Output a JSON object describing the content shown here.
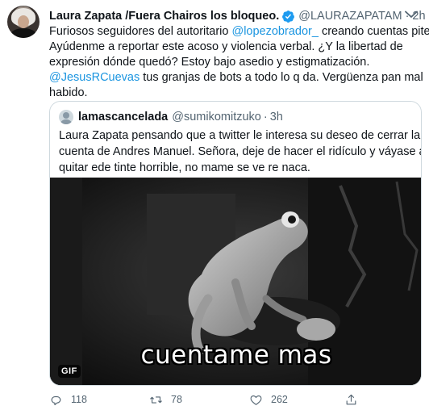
{
  "tweet": {
    "author_name": "Laura Zapata /Fuera Chairos los bloqueo.",
    "author_handle": "@LAURAZAPATAM",
    "separator": "·",
    "time": "2h",
    "text": {
      "line1_before": "Furiosos seguidores del autoritario ",
      "line1_mention": "@lopezobrador_",
      "line1_after": " creando cuentas piteras.",
      "line2": "Ayúdenme a reportar este acoso y violencia verbal. ¿Y la libertad de",
      "line3": "expresión dónde quedó? Estoy bajo asedio y estigmatización.",
      "line4_mention": "@JesusRCuevas",
      "line4_after": " tus granjas de bots a todo lo q da. Vergüenza pan mal",
      "line5": "habido."
    },
    "icons": {
      "avatar": "avatar-photo",
      "verified": "verified-badge-icon",
      "more": "chevron-down-icon"
    },
    "colors": {
      "link": "#1b95e0",
      "verified": "#1d9bf0",
      "secondary_text": "#536471"
    }
  },
  "quote": {
    "author_name": "lamascancelada",
    "author_handle": "@sumikomitzuko",
    "separator": "·",
    "time": "3h",
    "lines": [
      "Laura Zapata pensando que a twitter le interesa su deseo de cerrar la",
      "cuenta de Andres Manuel. Señora, deje de hacer el ridículo y váyase a",
      "quitar ede tinte horrible, no mame se ve re naca."
    ],
    "media": {
      "badge": "GIF",
      "caption": "cuentame mas",
      "description_icon": "frog-gif-image"
    }
  },
  "actions": {
    "reply": {
      "icon": "reply-icon",
      "count": "118"
    },
    "retweet": {
      "icon": "retweet-icon",
      "count": "78"
    },
    "like": {
      "icon": "heart-icon",
      "count": "262"
    },
    "share": {
      "icon": "share-icon"
    }
  }
}
